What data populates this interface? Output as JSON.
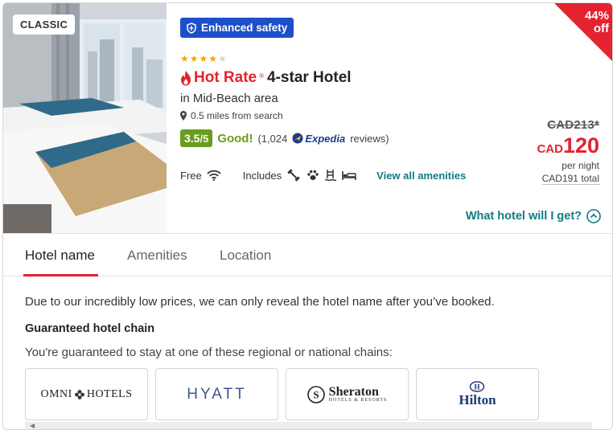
{
  "listing": {
    "tier_badge": "CLASSIC",
    "safety_badge": "Enhanced safety",
    "stars_filled": 4,
    "stars_total": 5,
    "hot_rate_label": "Hot Rate",
    "hot_rate_mark": "®",
    "hotel_class": "4-star Hotel",
    "area": "in Mid-Beach area",
    "distance": "0.5 miles from search",
    "rating_score": "3.5",
    "rating_denom": "/5",
    "rating_word": "Good!",
    "reviews_prefix": "(1,024",
    "reviews_brand": "Expedia",
    "reviews_suffix": "reviews)",
    "free_label": "Free",
    "includes_label": "Includes",
    "view_amenities": "View all amenities",
    "free_icons": [
      "wifi-icon"
    ],
    "included_icons": [
      "fitness-icon",
      "pet-icon",
      "pool-icon",
      "bed-icon"
    ]
  },
  "pricing": {
    "discount_pct": "44%",
    "discount_word": "off",
    "old_price": "CAD213",
    "old_price_marker": "*",
    "currency": "CAD",
    "price": "120",
    "per_night": "per night",
    "total": "CAD191 total",
    "what_hotel": "What hotel will I get?"
  },
  "tabs": [
    {
      "label": "Hotel name",
      "active": true
    },
    {
      "label": "Amenities",
      "active": false
    },
    {
      "label": "Location",
      "active": false
    }
  ],
  "panel": {
    "disclaimer": "Due to our incredibly low prices, we can only reveal the hotel name after you’ve booked.",
    "chain_title": "Guaranteed hotel chain",
    "chain_sub": "You're guaranteed to stay at one of these regional or national chains:",
    "chains": {
      "omni_left": "OMNI",
      "omni_right": "HOTELS",
      "hyatt": "HYATT",
      "sheraton": "Sheraton",
      "sheraton_sub": "HOTELS & RESORTS",
      "hilton": "Hilton"
    }
  },
  "colors": {
    "accent_red": "#e3232f",
    "teal_link": "#127b84",
    "safety_blue": "#1c4fc9",
    "rating_green": "#6a9c1e"
  }
}
